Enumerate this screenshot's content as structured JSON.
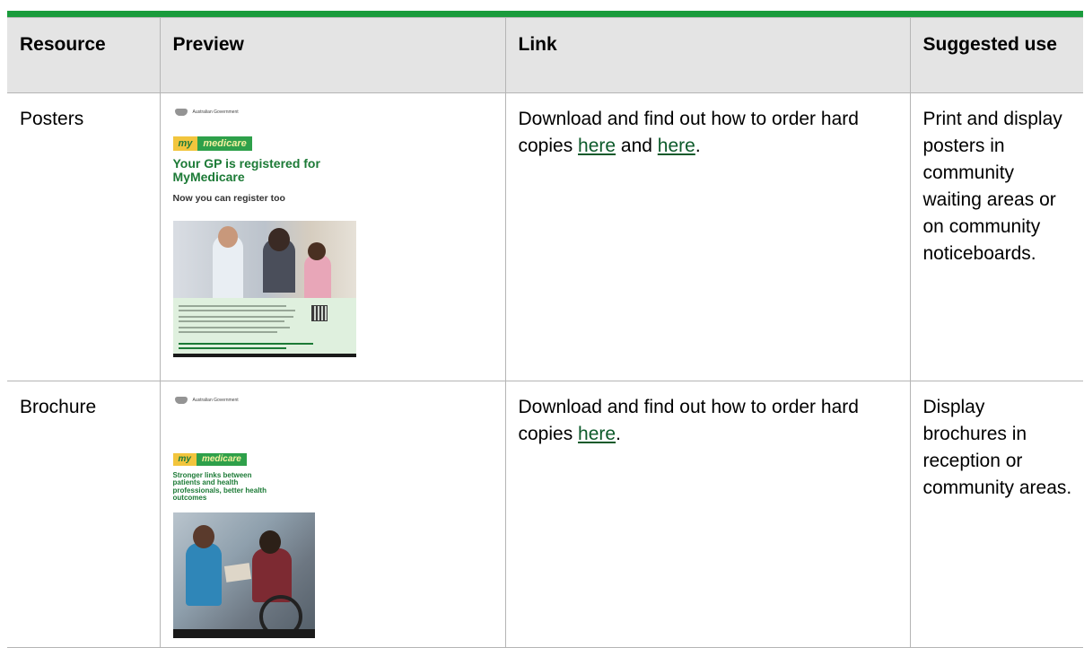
{
  "colors": {
    "accent_bar": "#1a9b3c",
    "header_bg": "#e4e4e4",
    "link": "#0c5a2a"
  },
  "headers": [
    "Resource",
    "Preview",
    "Link",
    "Suggested use"
  ],
  "rows": [
    {
      "resource": "Posters",
      "link_prefix": "Download and find out how to order hard copies ",
      "link1": "here",
      "link_and": " and ",
      "link2": "here",
      "link_suffix": ".",
      "suggested_use": "Print and display posters in community waiting areas or on community noticeboards.",
      "preview": {
        "gov_label": "Australian Government",
        "brand_my": "my",
        "brand_medicare": "medicare",
        "headline": "Your GP is registered for MyMedicare",
        "subhead": "Now you can register too"
      }
    },
    {
      "resource": "Brochure",
      "link_prefix": "Download and find out how to order hard copies ",
      "link1": "here",
      "link_suffix": ".",
      "suggested_use": "Display brochures in reception or community areas.",
      "preview": {
        "gov_label": "Australian Government",
        "brand_my": "my",
        "brand_medicare": "medicare",
        "headline": "Stronger links between patients and health professionals, better health outcomes"
      }
    }
  ]
}
